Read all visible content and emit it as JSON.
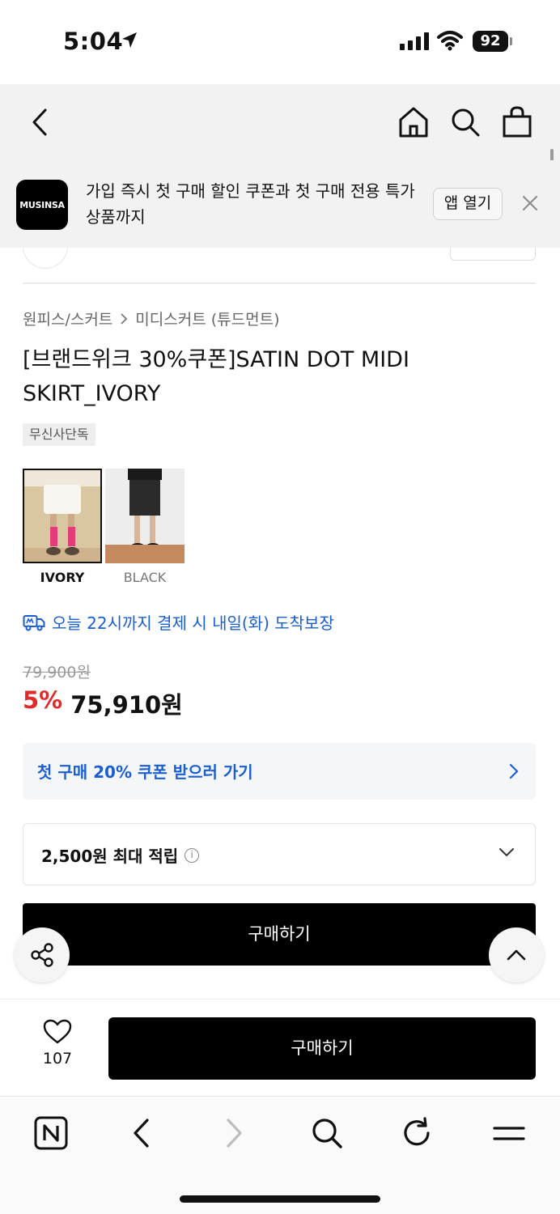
{
  "status": {
    "time": "5:04",
    "battery": "92"
  },
  "banner": {
    "logo": "MUSINSA",
    "text": "가입 즉시 첫 구매 할인 쿠폰과 첫 구매 전용 특가 상품까지",
    "open_label": "앱 열기"
  },
  "breadcrumb": {
    "category": "원피스/스커트",
    "subcategory": "미디스커트 (튜드먼트)"
  },
  "product": {
    "title": "[브랜드위크 30%쿠폰]SATIN DOT MIDI SKIRT_IVORY",
    "badge": "무신사단독"
  },
  "colors": [
    {
      "label": "IVORY",
      "selected": true
    },
    {
      "label": "BLACK",
      "selected": false
    }
  ],
  "delivery": "오늘 22시까지 결제 시 내일(화) 도착보장",
  "price": {
    "original": "79,900원",
    "discount": "5%",
    "final": "75,910원"
  },
  "coupon": {
    "text": "첫 구매 20% 쿠폰 받으러 가기"
  },
  "points": {
    "text": "2,500원 최대 적립"
  },
  "buttons": {
    "buy_main": "구매하기",
    "buy_bottom": "구매하기"
  },
  "likes": {
    "count": "107"
  },
  "theme": {
    "accent": "#1a5fd1",
    "sale": "#e12a2a",
    "primary": "#000000"
  }
}
